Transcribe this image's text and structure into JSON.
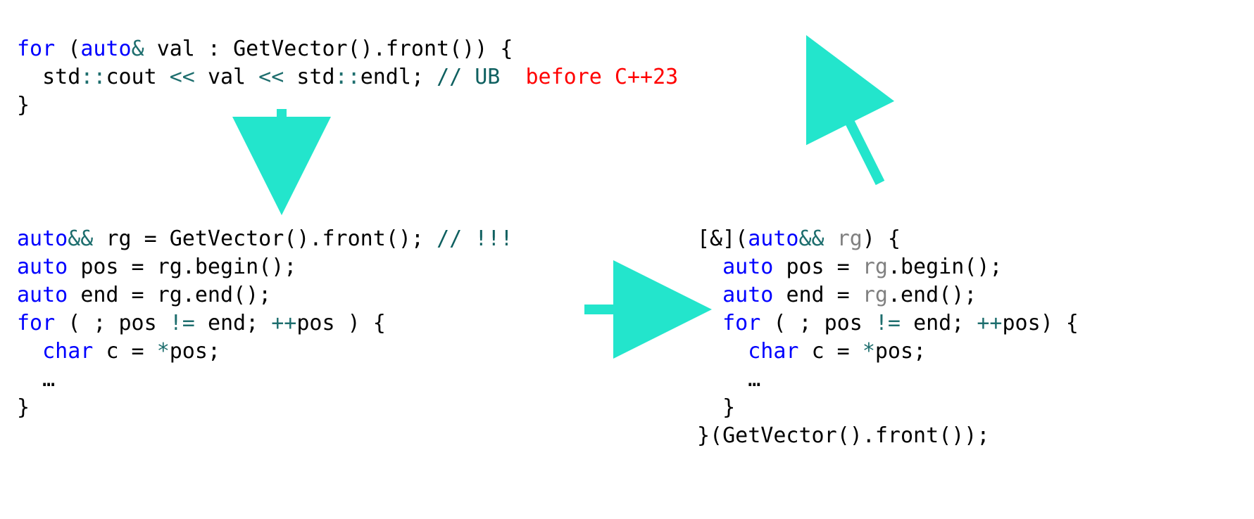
{
  "block_top": {
    "l1": {
      "kw1": "for",
      "p1": " (",
      "kw2": "auto",
      "amp": "& ",
      "id1": "val",
      "p2": " : ",
      "id2": "GetVector",
      "call1": "().",
      "id3": "front",
      "call2": "()) {"
    },
    "l2": {
      "ns1": "std",
      "cc1": "::",
      "io": "cout",
      "op1": " << ",
      "id1": "val",
      "op2": " << ",
      "ns2": "std",
      "cc2": "::",
      "endl": "endl",
      "sc": "; ",
      "cm": "// UB",
      "sp": "  ",
      "ann": "before C++23"
    },
    "l3": "}"
  },
  "block_left": {
    "l1": {
      "kw": "auto",
      "amp": "&& ",
      "id1": "rg",
      "eq": " = ",
      "id2": "GetVector",
      "c1": "().",
      "id3": "front",
      "c2": "(); ",
      "cm": "// !!!"
    },
    "l2": {
      "kw": "auto",
      "sp": " ",
      "id1": "pos",
      "eq": " = ",
      "id2": "rg",
      "dot": ".",
      "id3": "begin",
      "c": "();"
    },
    "l3": {
      "kw": "auto",
      "sp": " ",
      "id1": "end",
      "eq": " = ",
      "id2": "rg",
      "dot": ".",
      "id3": "end",
      "c": "();"
    },
    "l4": {
      "kw": "for",
      "p": " ( ; ",
      "id1": "pos",
      "op": " != ",
      "id2": "end",
      "sc": "; ",
      "inc": "++",
      "id3": "pos",
      "end": " ) {"
    },
    "l5": {
      "pad": "  ",
      "kw": "char",
      "sp": " ",
      "id1": "c",
      "eq": " = ",
      "deref": "*",
      "id2": "pos",
      "sc": ";"
    },
    "l6": "  …",
    "l7": "}"
  },
  "block_right": {
    "l1": {
      "p1": "[&](",
      "kw": "auto",
      "amp": "&& ",
      "id": "rg",
      "p2": ") {"
    },
    "l2": {
      "pad": "  ",
      "kw": "auto",
      "sp": " ",
      "id1": "pos",
      "eq": " = ",
      "id2": "rg",
      "dot": ".",
      "id3": "begin",
      "c": "();"
    },
    "l3": {
      "pad": "  ",
      "kw": "auto",
      "sp": " ",
      "id1": "end",
      "eq": " = ",
      "id2": "rg",
      "dot": ".",
      "id3": "end",
      "c": "();"
    },
    "l4": {
      "pad": "  ",
      "kw": "for",
      "p": " ( ; ",
      "id1": "pos",
      "op": " != ",
      "id2": "end",
      "sc": "; ",
      "inc": "++",
      "id3": "pos",
      "end": ") {"
    },
    "l5": {
      "pad": "    ",
      "kw": "char",
      "sp": " ",
      "id1": "c",
      "eq": " = ",
      "deref": "*",
      "id2": "pos",
      "sc": ";"
    },
    "l6": "    …",
    "l7": "  }",
    "l8": {
      "p1": "}(",
      "id1": "GetVector",
      "c1": "().",
      "id2": "front",
      "c2": "());"
    }
  },
  "colors": {
    "arrow": "#23e5cc"
  }
}
